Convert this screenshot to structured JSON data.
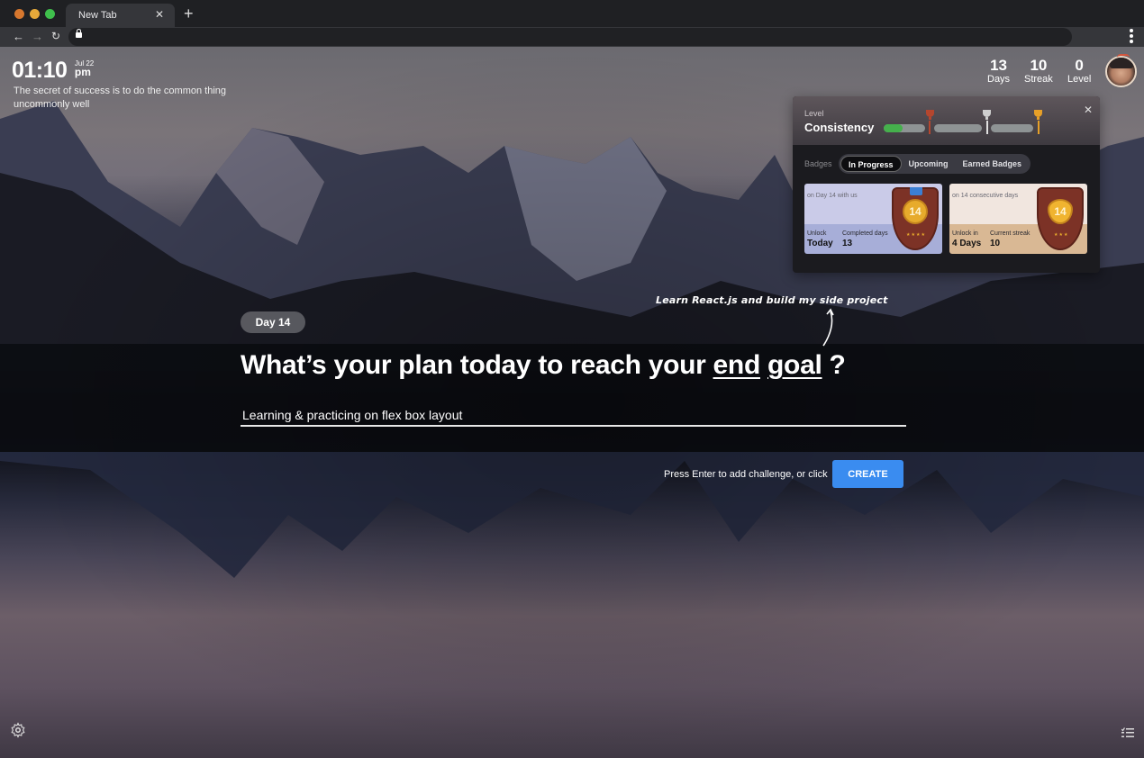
{
  "browser": {
    "tab_title": "New Tab",
    "traffic_colors": [
      "#d6772e",
      "#e6a93a",
      "#3fbf4c"
    ]
  },
  "clock": {
    "time": "01:10",
    "date": "Jul 22",
    "ampm": "pm"
  },
  "quote": "The secret of success is to do the common thing uncommonly well",
  "stats": [
    {
      "value": "13",
      "label": "Days"
    },
    {
      "value": "10",
      "label": "Streak"
    },
    {
      "value": "0",
      "label": "Level"
    }
  ],
  "level_panel": {
    "label": "Level",
    "title": "Consistency",
    "progress_fraction": 0.45,
    "trophy_colors": [
      "#b5462e",
      "#cfcfcf",
      "#e7a028"
    ],
    "badges_label": "Badges",
    "tabs": [
      {
        "label": "In Progress",
        "active": true
      },
      {
        "label": "Upcoming",
        "active": false
      },
      {
        "label": "Earned Badges",
        "active": false
      }
    ],
    "cards": [
      {
        "description": "on Day 14 with us",
        "left_key": "Unlock",
        "left_value": "Today",
        "right_key": "Completed days",
        "right_value": "13",
        "badge_number": "14",
        "top_color": "#cacbe8",
        "bottom_color": "#a7aed8"
      },
      {
        "description": "on 14 consecutive days",
        "left_key": "Unlock in",
        "left_value": "4 Days",
        "right_key": "Current streak",
        "right_value": "10",
        "badge_number": "14",
        "top_color": "#f1e6df",
        "bottom_color": "#d9b894"
      }
    ]
  },
  "main": {
    "day_pill": "Day 14",
    "handwritten_hint": "Learn React.js and build my side project",
    "headline_prefix": "What’s your plan today to reach your ",
    "headline_emphasis_1": "end",
    "headline_emphasis_2": "goal",
    "headline_suffix": " ?",
    "input_value": "Learning & practicing on flex box layout",
    "press_hint": "Press Enter to add challenge, or click",
    "create_label": "CREATE",
    "accent_color": "#3a8cf0"
  }
}
